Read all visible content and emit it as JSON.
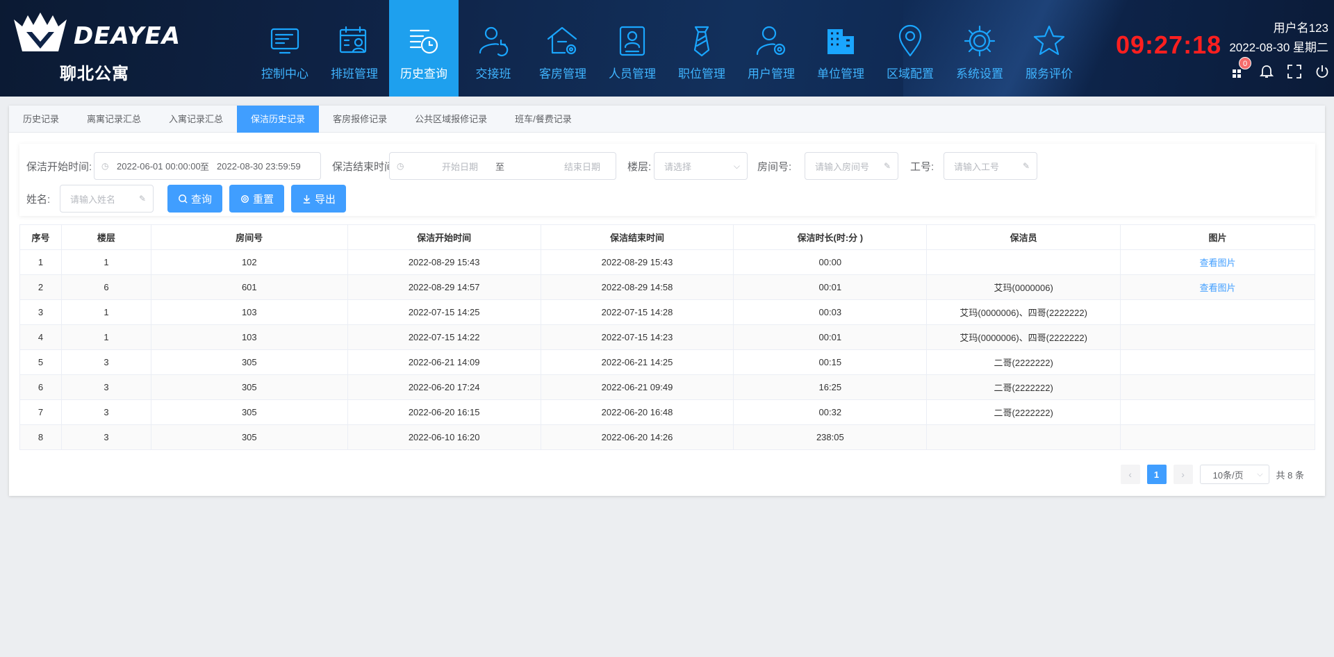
{
  "brand": {
    "name": "DEAYEA",
    "subtitle": "聊北公寓"
  },
  "nav": [
    {
      "label": "控制中心",
      "icon": "monitor-icon"
    },
    {
      "label": "排班管理",
      "icon": "calendar-user-icon"
    },
    {
      "label": "历史查询",
      "icon": "history-clock-icon",
      "active": true
    },
    {
      "label": "交接班",
      "icon": "user-refresh-icon"
    },
    {
      "label": "客房管理",
      "icon": "house-gear-icon"
    },
    {
      "label": "人员管理",
      "icon": "id-card-icon"
    },
    {
      "label": "职位管理",
      "icon": "tie-icon"
    },
    {
      "label": "用户管理",
      "icon": "user-gear-icon"
    },
    {
      "label": "单位管理",
      "icon": "building-icon"
    },
    {
      "label": "区域配置",
      "icon": "location-pin-icon"
    },
    {
      "label": "系统设置",
      "icon": "gear-icon"
    },
    {
      "label": "服务评价",
      "icon": "star-icon"
    }
  ],
  "header": {
    "time": "09:27:18",
    "user": "用户名123",
    "date": "2022-08-30 星期二",
    "notify_count": "0"
  },
  "tabs": [
    "历史记录",
    "离寓记录汇总",
    "入寓记录汇总",
    "保洁历史记录",
    "客房报修记录",
    "公共区域报修记录",
    "班车/餐费记录"
  ],
  "filter": {
    "start_label": "保洁开始时间:",
    "start_from": "2022-06-01 00:00:00",
    "range_sep": "至",
    "start_to": "2022-08-30 23:59:59",
    "end_label": "保洁结束时间:",
    "end_from_ph": "开始日期",
    "end_to_ph": "结束日期",
    "floor_label": "楼层:",
    "floor_ph": "请选择",
    "room_label": "房间号:",
    "room_ph": "请输入房间号",
    "emp_label": "工号:",
    "emp_ph": "请输入工号",
    "name_label": "姓名:",
    "name_ph": "请输入姓名",
    "query_btn": "查询",
    "reset_btn": "重置",
    "export_btn": "导出"
  },
  "table": {
    "columns": [
      "序号",
      "楼层",
      "房间号",
      "保洁开始时间",
      "保洁结束时间",
      "保洁时长(时:分 )",
      "保洁员",
      "图片"
    ],
    "rows": [
      [
        "1",
        "1",
        "102",
        "2022-08-29 15:43",
        "2022-08-29 15:43",
        "00:00",
        "",
        "查看图片"
      ],
      [
        "2",
        "6",
        "601",
        "2022-08-29 14:57",
        "2022-08-29 14:58",
        "00:01",
        "艾玛(0000006)",
        "查看图片"
      ],
      [
        "3",
        "1",
        "103",
        "2022-07-15 14:25",
        "2022-07-15 14:28",
        "00:03",
        "艾玛(0000006)、四哥(2222222)",
        ""
      ],
      [
        "4",
        "1",
        "103",
        "2022-07-15 14:22",
        "2022-07-15 14:23",
        "00:01",
        "艾玛(0000006)、四哥(2222222)",
        ""
      ],
      [
        "5",
        "3",
        "305",
        "2022-06-21 14:09",
        "2022-06-21 14:25",
        "00:15",
        "二哥(2222222)",
        ""
      ],
      [
        "6",
        "3",
        "305",
        "2022-06-20 17:24",
        "2022-06-21 09:49",
        "16:25",
        "二哥(2222222)",
        ""
      ],
      [
        "7",
        "3",
        "305",
        "2022-06-20 16:15",
        "2022-06-20 16:48",
        "00:32",
        "二哥(2222222)",
        ""
      ],
      [
        "8",
        "3",
        "305",
        "2022-06-10 16:20",
        "2022-06-20 14:26",
        "238:05",
        "",
        ""
      ]
    ]
  },
  "pagination": {
    "current": "1",
    "page_size": "10条/页",
    "total": "共 8 条"
  },
  "colors": {
    "accent": "#409eff",
    "nav_active": "#1ea0ee",
    "nav_text": "#3fb4ff",
    "clock": "#ff1f1f",
    "header_bg": "#0f2448"
  }
}
